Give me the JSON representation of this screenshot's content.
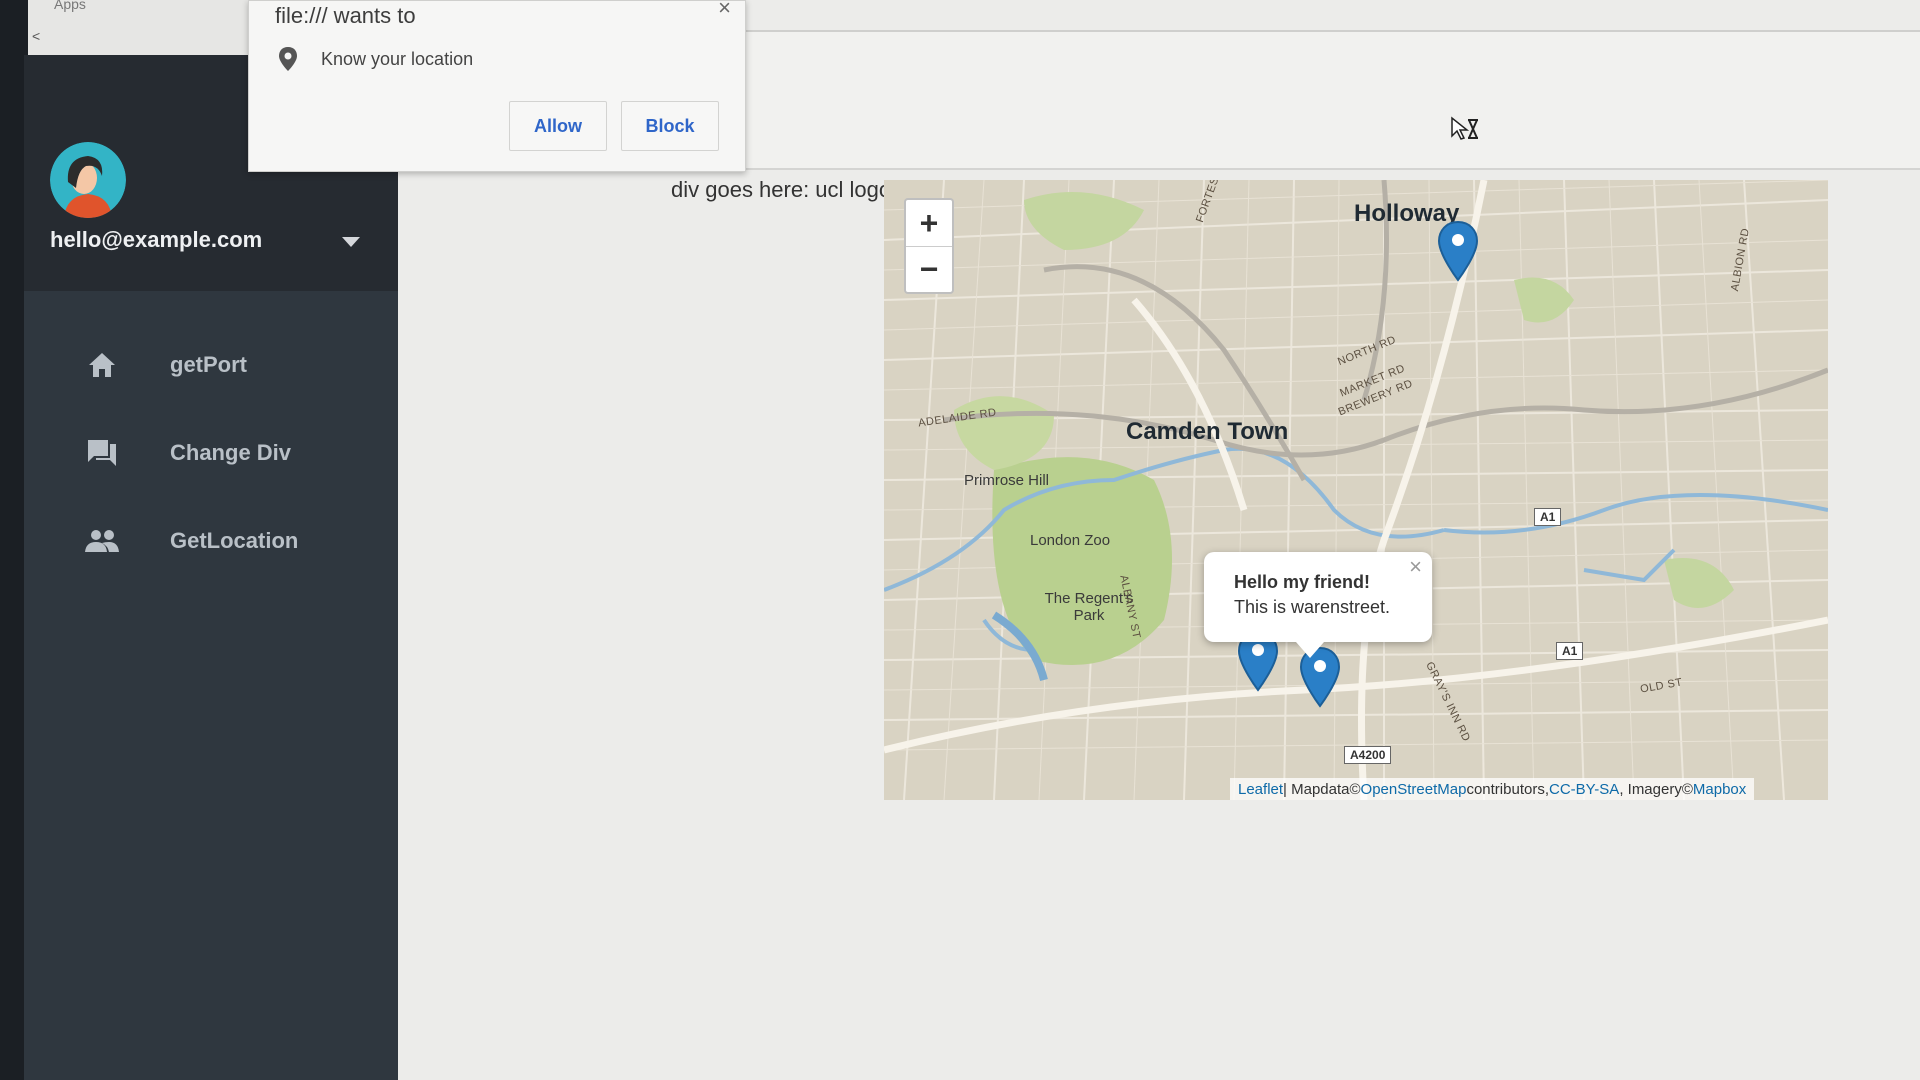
{
  "browser": {
    "back": "<",
    "apps": "Apps"
  },
  "permission": {
    "title": "file:/// wants to",
    "close": "×",
    "text": "Know your location",
    "allow": "Allow",
    "block": "Block"
  },
  "sidebar": {
    "email": "hello@example.com",
    "items": [
      {
        "label": "getPort",
        "icon": "home-icon"
      },
      {
        "label": "Change Div",
        "icon": "chat-icon"
      },
      {
        "label": "GetLocation",
        "icon": "people-icon"
      }
    ]
  },
  "main": {
    "placeholder": "div goes here: ucl logo"
  },
  "map": {
    "zoom_in": "+",
    "zoom_out": "−",
    "places": {
      "holloway": "Holloway",
      "camden": "Camden Town",
      "primrose": "Primrose Hill",
      "zoo": "London Zoo",
      "regents": "The Regent's Park"
    },
    "roads": {
      "fortess": "FORTESS RD",
      "north": "NORTH RD",
      "market": "MARKET RD",
      "brewery": "BREWERY RD",
      "adelaide": "ADELAIDE RD",
      "albany": "ALBANY ST",
      "grays": "GRAY'S INN RD",
      "old": "OLD ST",
      "albion": "ALBION RD"
    },
    "shields": {
      "a1_top": "A1",
      "a1_bottom": "A1",
      "a4200": "A4200"
    },
    "popup": {
      "title": "Hello my friend!",
      "body": "This is warenstreet.",
      "close": "×"
    },
    "attribution": {
      "leaflet": "Leaflet",
      "sep": " | Mapdata©",
      "osm": "OpenStreetMap",
      "contrib": "contributors,",
      "license": "CC-BY-SA",
      "imagery": ", Imagery©",
      "mapbox": "Mapbox"
    }
  },
  "colors": {
    "sidebar_bg": "#2f373f",
    "sidebar_head": "#262b31",
    "link_blue": "#2f66c9",
    "marker_blue": "#2a7fc7",
    "park_green": "#b6cf8f"
  }
}
